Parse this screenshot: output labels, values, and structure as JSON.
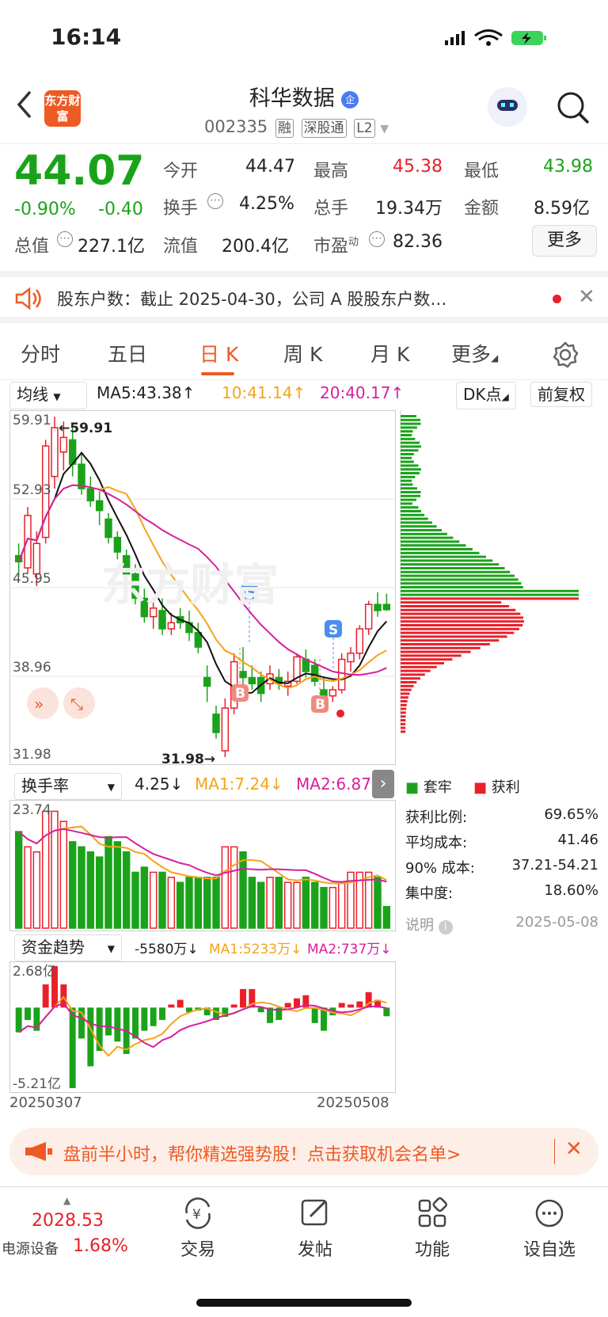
{
  "status": {
    "time": "16:14"
  },
  "header": {
    "logo": "东方财富",
    "name": "科华数据",
    "badge": "企",
    "code": "002335",
    "tags": [
      "融",
      "深股通",
      "L2"
    ]
  },
  "quote": {
    "price": "44.07",
    "pct": "-0.90%",
    "chg": "-0.40",
    "open_label": "今开",
    "open": "44.47",
    "high_label": "最高",
    "high": "45.38",
    "low_label": "最低",
    "low": "43.98",
    "turn_label": "换手",
    "turn": "4.25%",
    "vol_label": "总手",
    "vol": "19.34万",
    "amt_label": "金额",
    "amt": "8.59亿",
    "mcap_label": "总值",
    "mcap": "227.1亿",
    "float_label": "流值",
    "float": "200.4亿",
    "pe_label": "市盈",
    "pe_sup": "动",
    "pe": "82.36",
    "more": "更多"
  },
  "notice": {
    "text": "股东户数：截止 2025-04-30，公司 A 股股东户数…"
  },
  "tabs": [
    "分时",
    "五日",
    "日 K",
    "周 K",
    "月 K",
    "更多"
  ],
  "kline": {
    "selector": "均线",
    "ma5": "MA5:43.38↑",
    "ma10": "10:41.14↑",
    "ma20": "20:40.17↑",
    "dk": "DK点",
    "fq": "前复权",
    "y_labels": [
      "59.91",
      "52.93",
      "45.95",
      "38.96",
      "31.98"
    ],
    "max_label": "59.91",
    "min_label": "31.98→"
  },
  "chip": {
    "legend_a": "套牢",
    "legend_b": "获利",
    "rows": [
      {
        "k": "获利比例:",
        "v": "69.65%"
      },
      {
        "k": "平均成本:",
        "v": "41.46"
      },
      {
        "k": "90% 成本:",
        "v": "37.21-54.21"
      },
      {
        "k": "集中度:",
        "v": "18.60%"
      }
    ],
    "note": "说明",
    "date": "2025-05-08"
  },
  "turnover": {
    "selector": "换手率",
    "val": "4.25↓",
    "ma1": "MA1:7.24↓",
    "ma2": "MA2:6.87",
    "ymax": "23.74"
  },
  "fund": {
    "selector": "资金趋势",
    "val": "-5580万↓",
    "ma1": "MA1:5233万↓",
    "ma2": "MA2:737万↓",
    "ymax": "2.68亿",
    "ymin": "-5.21亿",
    "d1": "20250307",
    "d2": "20250508"
  },
  "banner": {
    "text": "盘前半小时，帮你精选强势股！点击获取机会名单>"
  },
  "bottom": {
    "index": "2028.53",
    "sector": "电源设备",
    "sector_pct": "1.68%",
    "items": [
      "交易",
      "发帖",
      "功能",
      "设自选"
    ]
  },
  "colors": {
    "up": "#e8202a",
    "down": "#1aa31a",
    "accent": "#ee5a23"
  },
  "chart_data": {
    "type": "candlestick",
    "x_range": [
      "20250307",
      "20250508"
    ],
    "ylim": [
      31.98,
      59.91
    ],
    "ohlc": [
      [
        48.5,
        49.5,
        46.8,
        48.0
      ],
      [
        47.5,
        52.5,
        47.0,
        51.8
      ],
      [
        47.0,
        50.5,
        46.0,
        49.5
      ],
      [
        50.0,
        58.0,
        49.5,
        57.5
      ],
      [
        55.0,
        59.9,
        54.0,
        59.0
      ],
      [
        57.0,
        59.5,
        55.5,
        58.2
      ],
      [
        58.0,
        59.2,
        55.0,
        56.0
      ],
      [
        56.0,
        57.0,
        53.5,
        54.0
      ],
      [
        54.0,
        55.0,
        52.5,
        53.0
      ],
      [
        53.0,
        53.8,
        51.0,
        52.2
      ],
      [
        51.5,
        52.0,
        49.5,
        50.0
      ],
      [
        50.0,
        50.5,
        48.2,
        48.8
      ],
      [
        48.5,
        49.0,
        46.5,
        47.0
      ],
      [
        47.0,
        47.8,
        44.5,
        45.0
      ],
      [
        45.0,
        45.8,
        43.0,
        43.5
      ],
      [
        43.5,
        44.8,
        42.5,
        44.2
      ],
      [
        44.0,
        45.0,
        42.0,
        42.5
      ],
      [
        42.5,
        43.8,
        42.0,
        43.0
      ],
      [
        43.5,
        44.2,
        42.5,
        43.0
      ],
      [
        43.0,
        44.0,
        41.5,
        42.2
      ],
      [
        42.2,
        43.0,
        40.5,
        41.0
      ],
      [
        38.5,
        39.5,
        36.5,
        37.8
      ],
      [
        35.5,
        36.2,
        33.5,
        34.0
      ],
      [
        32.5,
        36.8,
        31.98,
        36.0
      ],
      [
        36.0,
        40.5,
        35.5,
        39.8
      ],
      [
        39.0,
        41.0,
        37.5,
        38.5
      ],
      [
        38.5,
        39.5,
        37.5,
        38.0
      ],
      [
        38.5,
        39.0,
        36.5,
        37.2
      ],
      [
        38.0,
        39.5,
        37.5,
        38.8
      ],
      [
        38.5,
        39.2,
        37.5,
        38.0
      ],
      [
        37.8,
        39.0,
        37.0,
        38.2
      ],
      [
        38.2,
        40.5,
        38.0,
        40.2
      ],
      [
        40.0,
        40.8,
        38.5,
        39.0
      ],
      [
        39.5,
        40.0,
        37.8,
        38.2
      ],
      [
        37.5,
        38.5,
        36.5,
        37.0
      ],
      [
        37.0,
        37.8,
        36.5,
        37.5
      ],
      [
        37.5,
        40.5,
        37.2,
        40.0
      ],
      [
        39.8,
        41.0,
        39.0,
        40.5
      ],
      [
        40.5,
        42.8,
        40.0,
        42.5
      ],
      [
        42.5,
        44.8,
        42.0,
        44.5
      ],
      [
        44.5,
        45.5,
        43.5,
        44.0
      ],
      [
        44.5,
        45.38,
        43.98,
        44.07
      ]
    ],
    "turnover": [
      19,
      16,
      15,
      23,
      23,
      21,
      17,
      16,
      15,
      14,
      18,
      17,
      15,
      11,
      12,
      11,
      11,
      10,
      9,
      10,
      10,
      10,
      10,
      16,
      16,
      15,
      10,
      9,
      10,
      10,
      9,
      9,
      10,
      9,
      8,
      8,
      9,
      11,
      11,
      11,
      10,
      4.25
    ],
    "fund_flow": [
      -1.6,
      -0.8,
      -1.5,
      1.5,
      2.68,
      1.5,
      -5.21,
      -2.0,
      -3.8,
      -2.8,
      -1.8,
      -2.2,
      -3.0,
      -2.0,
      -1.5,
      -1.2,
      -0.8,
      0.2,
      0.5,
      -0.3,
      -0.2,
      -0.5,
      -0.8,
      -0.6,
      0.2,
      1.2,
      1.2,
      -0.3,
      -1.0,
      -0.8,
      0.3,
      0.6,
      0.8,
      -1.0,
      -1.5,
      -0.5,
      0.3,
      0.2,
      0.4,
      1.0,
      0.5,
      -0.56
    ]
  }
}
